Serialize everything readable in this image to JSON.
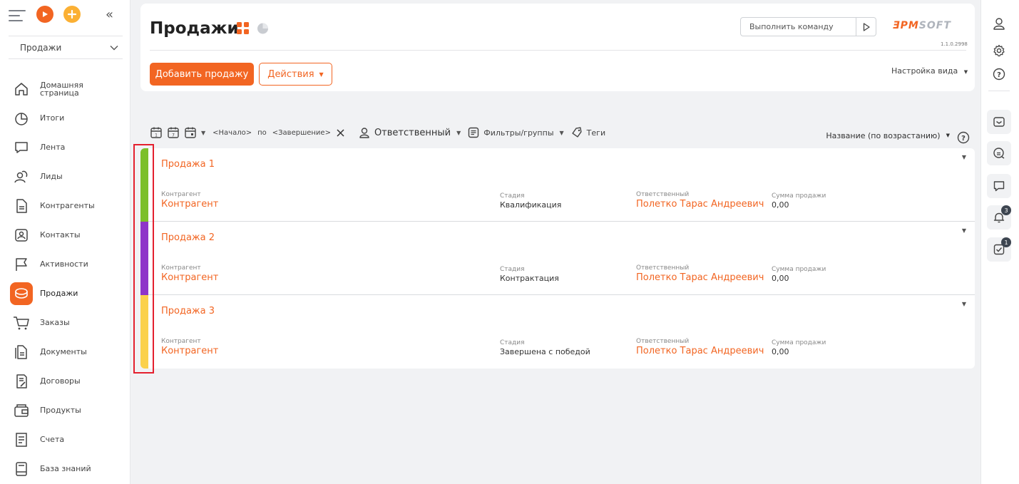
{
  "sidebar": {
    "workplace": "Продажи",
    "items": [
      {
        "label": "Домашняя страница",
        "icon": "home-icon"
      },
      {
        "label": "Итоги",
        "icon": "pie-chart-icon"
      },
      {
        "label": "Лента",
        "icon": "chat-bubble-icon"
      },
      {
        "label": "Лиды",
        "icon": "leads-icon"
      },
      {
        "label": "Контрагенты",
        "icon": "document-icon"
      },
      {
        "label": "Контакты",
        "icon": "contact-card-icon"
      },
      {
        "label": "Активности",
        "icon": "flag-icon"
      },
      {
        "label": "Продажи",
        "icon": "coins-icon"
      },
      {
        "label": "Заказы",
        "icon": "cart-icon"
      },
      {
        "label": "Документы",
        "icon": "documents-icon"
      },
      {
        "label": "Договоры",
        "icon": "contract-icon"
      },
      {
        "label": "Продукты",
        "icon": "wallet-icon"
      },
      {
        "label": "Счета",
        "icon": "invoice-icon"
      },
      {
        "label": "База знаний",
        "icon": "knowledge-base-icon"
      }
    ]
  },
  "header": {
    "title": "Продажи",
    "command_placeholder": "Выполнить команду",
    "logo_part1": "ƎPM",
    "logo_part2": "SOFT",
    "version": "1.1.0.2998",
    "add_button": "Добавить продажу",
    "actions_button": "Действия",
    "view_settings": "Настройка вида"
  },
  "filters": {
    "start": "<Начало>",
    "by": "по",
    "end": "<Завершение>",
    "owner": "Ответственный",
    "filters_groups": "Фильтры/группы",
    "tags": "Теги",
    "sort": "Название (по возрастанию)"
  },
  "colors": {
    "accent": "#f26522",
    "highlight": "#e4202e"
  },
  "rows": [
    {
      "title": "Продажа 1",
      "color": "#7cbf2a",
      "account_label": "Контрагент",
      "account_value": "Контрагент",
      "stage_label": "Стадия",
      "stage_value": "Квалификация",
      "owner_label": "Ответственный",
      "owner_value": "Полетко Тарас Андреевич",
      "amount_label": "Сумма продажи",
      "amount_value": "0,00"
    },
    {
      "title": "Продажа 2",
      "color": "#8e35c9",
      "account_label": "Контрагент",
      "account_value": "Контрагент",
      "stage_label": "Стадия",
      "stage_value": "Контрактация",
      "owner_label": "Ответственный",
      "owner_value": "Полетко Тарас Андреевич",
      "amount_label": "Сумма продажи",
      "amount_value": "0,00"
    },
    {
      "title": "Продажа 3",
      "color": "#fbd14b",
      "account_label": "Контрагент",
      "account_value": "Контрагент",
      "stage_label": "Стадия",
      "stage_value": "Завершена с победой",
      "owner_label": "Ответственный",
      "owner_value": "Полетко Тарас Андреевич",
      "amount_label": "Сумма продажи",
      "amount_value": "0,00"
    }
  ],
  "right_sidebar": {
    "notifications_count": "3",
    "tasks_count": "1"
  }
}
